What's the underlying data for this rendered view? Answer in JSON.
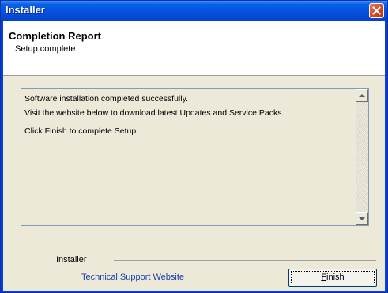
{
  "window": {
    "title": "Installer"
  },
  "header": {
    "title": "Completion Report",
    "subtitle": "Setup complete"
  },
  "message": {
    "lines": [
      "Software installation completed successfully.",
      "Visit the website below to download latest Updates and Service Packs.",
      "Click Finish to complete Setup."
    ]
  },
  "footer": {
    "group_label": "Installer",
    "support_link": "Technical Support Website",
    "finish_accel": "F",
    "finish_rest": "inish"
  },
  "colors": {
    "titlebar": "#0553e0",
    "close_button": "#d5461f",
    "link": "#1a3fa6",
    "dialog_background": "#ece9d8"
  },
  "icons": {
    "close": "close-x-icon",
    "scroll_up": "arrow-up-icon",
    "scroll_down": "arrow-down-icon"
  }
}
